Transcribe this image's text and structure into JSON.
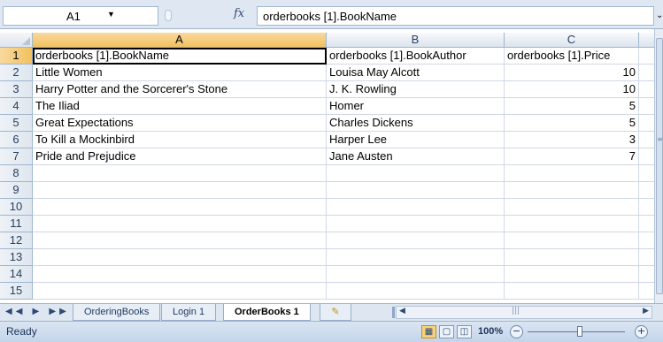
{
  "formula_bar": {
    "name_box": "A1",
    "fx_label": "fx",
    "formula": "orderbooks [1].BookName"
  },
  "columns": [
    "A",
    "B",
    "C"
  ],
  "rows": [
    {
      "num": "1",
      "a": "orderbooks [1].BookName",
      "b": "orderbooks [1].BookAuthor",
      "c": "orderbooks [1].Price"
    },
    {
      "num": "2",
      "a": "Little Women",
      "b": "Louisa May Alcott",
      "c": "10"
    },
    {
      "num": "3",
      "a": "Harry Potter and the Sorcerer's Stone",
      "b": "J. K. Rowling",
      "c": "10"
    },
    {
      "num": "4",
      "a": "The Iliad",
      "b": "Homer",
      "c": "5"
    },
    {
      "num": "5",
      "a": "Great Expectations",
      "b": "Charles Dickens",
      "c": "5"
    },
    {
      "num": "6",
      "a": "To Kill a Mockinbird",
      "b": "Harper Lee",
      "c": "3"
    },
    {
      "num": "7",
      "a": "Pride and Prejudice",
      "b": "Jane Austen",
      "c": "7"
    },
    {
      "num": "8",
      "a": "",
      "b": "",
      "c": ""
    },
    {
      "num": "9",
      "a": "",
      "b": "",
      "c": ""
    },
    {
      "num": "10",
      "a": "",
      "b": "",
      "c": ""
    },
    {
      "num": "11",
      "a": "",
      "b": "",
      "c": ""
    },
    {
      "num": "12",
      "a": "",
      "b": "",
      "c": ""
    },
    {
      "num": "13",
      "a": "",
      "b": "",
      "c": ""
    },
    {
      "num": "14",
      "a": "",
      "b": "",
      "c": ""
    },
    {
      "num": "15",
      "a": "",
      "b": "",
      "c": ""
    }
  ],
  "sheet_tabs": [
    "OrderingBooks",
    "Login 1",
    "OrderBooks 1"
  ],
  "status": {
    "text": "Ready",
    "zoom": "100%"
  }
}
